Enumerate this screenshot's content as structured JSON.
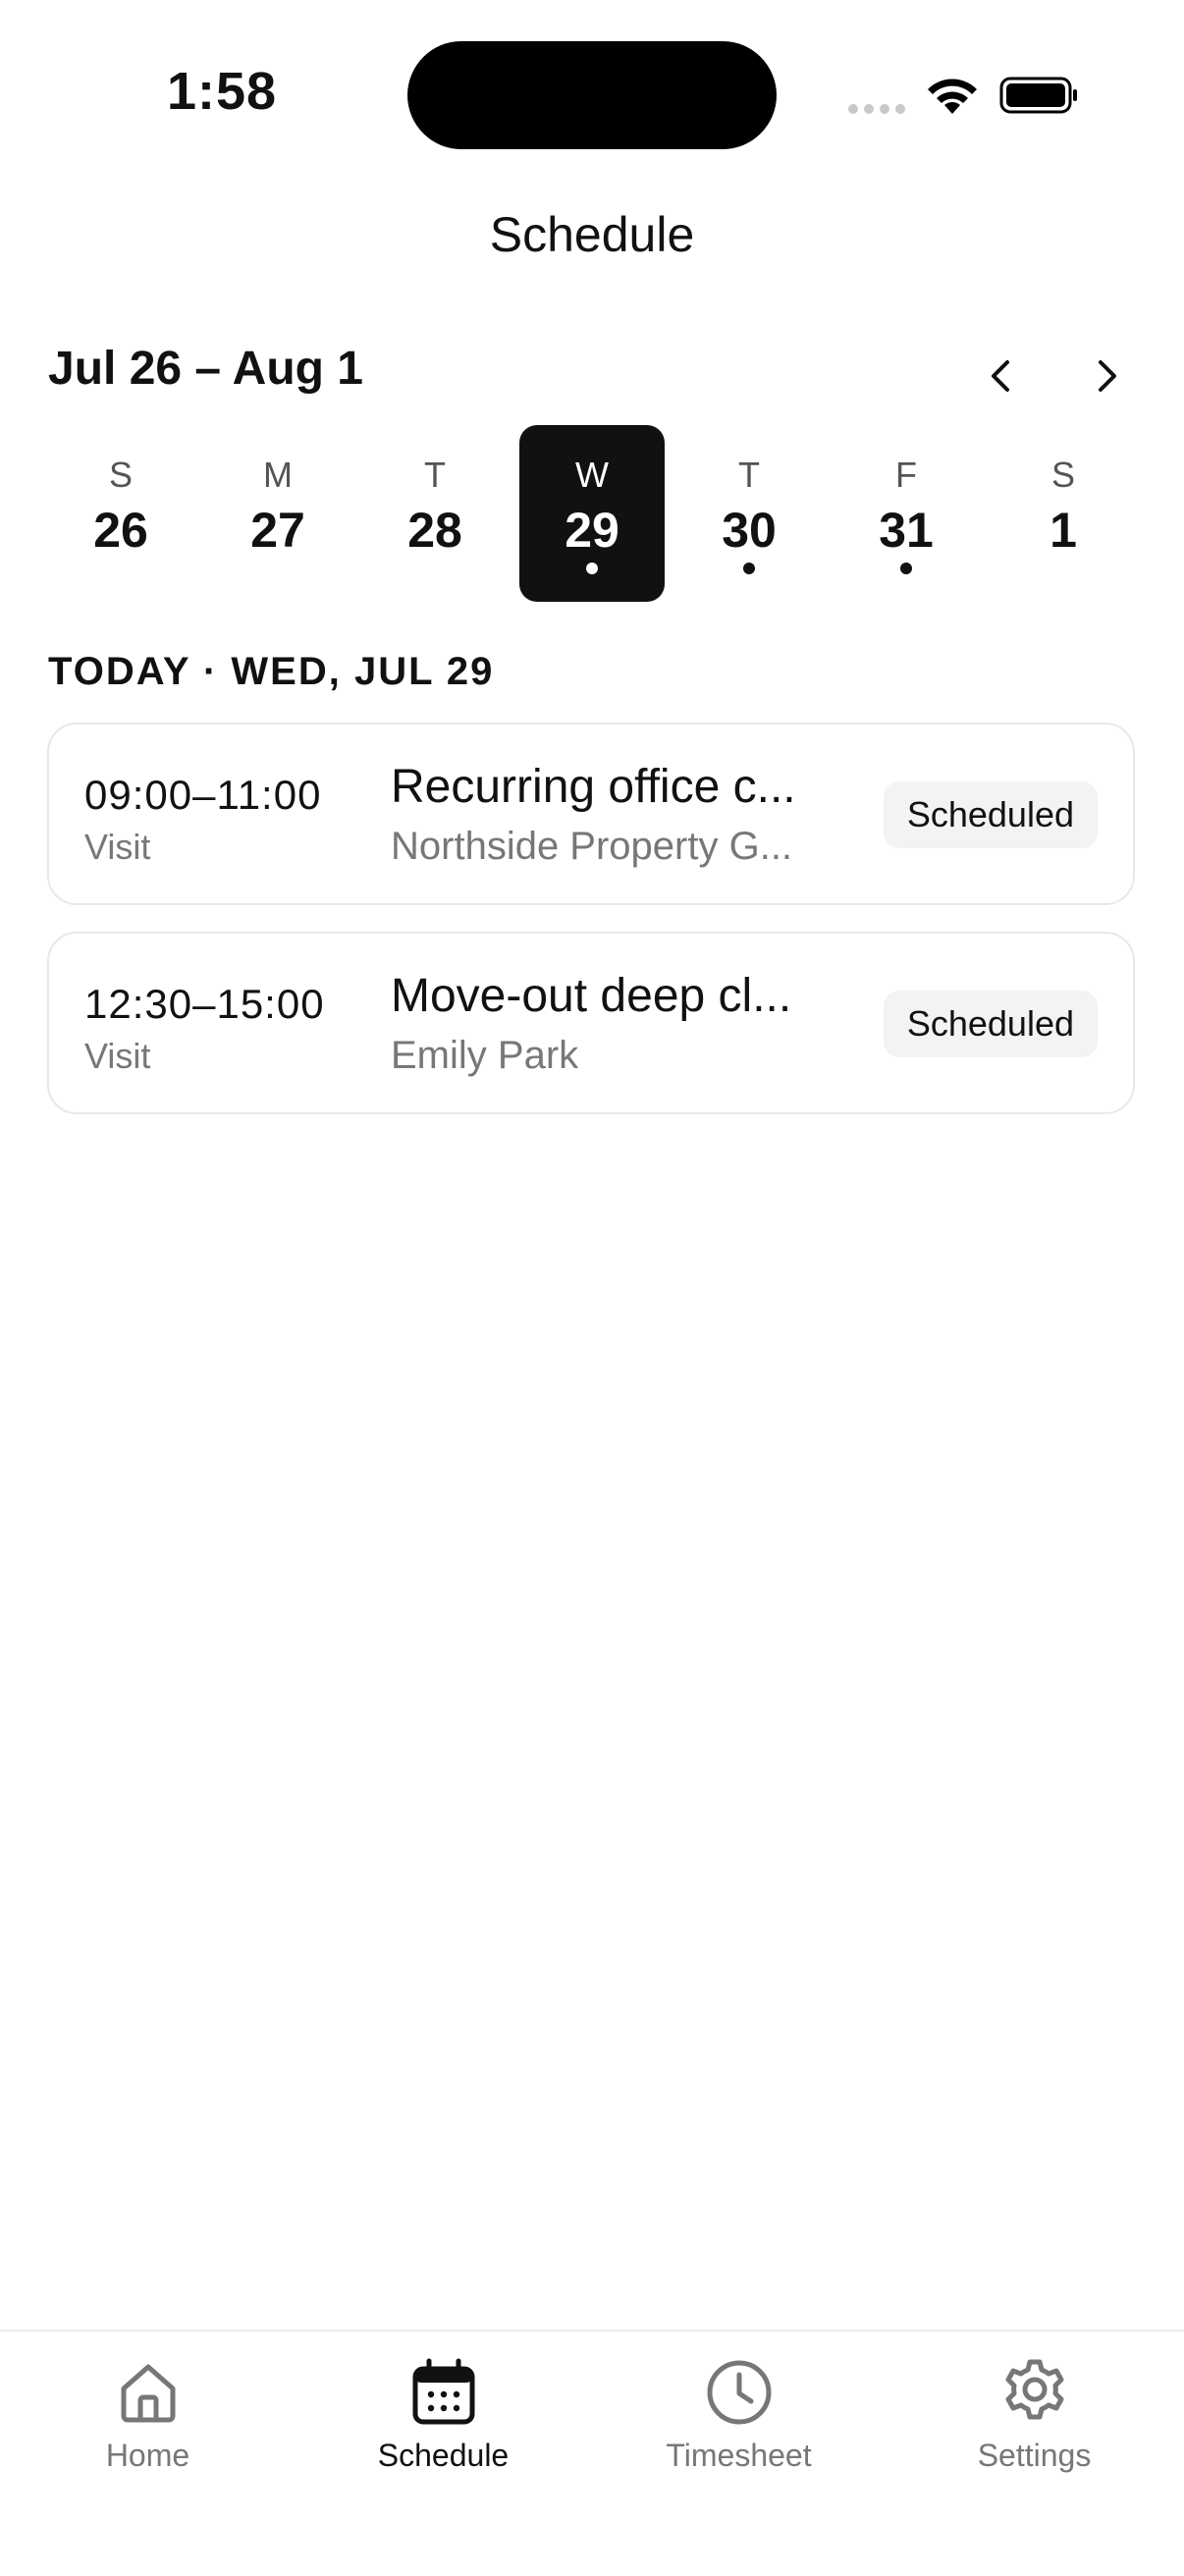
{
  "status_bar": {
    "time": "1:58"
  },
  "header": {
    "title": "Schedule"
  },
  "week": {
    "range_label": "Jul 26 – Aug 1",
    "days": [
      {
        "dow": "S",
        "num": "26",
        "has_visits": false,
        "selected": false
      },
      {
        "dow": "M",
        "num": "27",
        "has_visits": false,
        "selected": false
      },
      {
        "dow": "T",
        "num": "28",
        "has_visits": false,
        "selected": false
      },
      {
        "dow": "W",
        "num": "29",
        "has_visits": true,
        "selected": true
      },
      {
        "dow": "T",
        "num": "30",
        "has_visits": true,
        "selected": false
      },
      {
        "dow": "F",
        "num": "31",
        "has_visits": true,
        "selected": false
      },
      {
        "dow": "S",
        "num": "1",
        "has_visits": false,
        "selected": false
      }
    ]
  },
  "section": {
    "heading": "TODAY · WED, JUL 29"
  },
  "visits": [
    {
      "time": "09:00–11:00",
      "type": "Visit",
      "title": "Recurring office c...",
      "client": "Northside Property G...",
      "status": "Scheduled"
    },
    {
      "time": "12:30–15:00",
      "type": "Visit",
      "title": "Move-out deep cl...",
      "client": "Emily Park",
      "status": "Scheduled"
    }
  ],
  "tab_bar": {
    "tabs": [
      {
        "label": "Home",
        "icon": "home-icon",
        "active": false
      },
      {
        "label": "Schedule",
        "icon": "calendar-icon",
        "active": true
      },
      {
        "label": "Timesheet",
        "icon": "clock-icon",
        "active": false
      },
      {
        "label": "Settings",
        "icon": "gear-icon",
        "active": false
      }
    ]
  },
  "colors": {
    "primary": "#111111",
    "muted": "#777777",
    "badge_bg": "#f3f3f3",
    "card_border": "#e8e8e8"
  }
}
